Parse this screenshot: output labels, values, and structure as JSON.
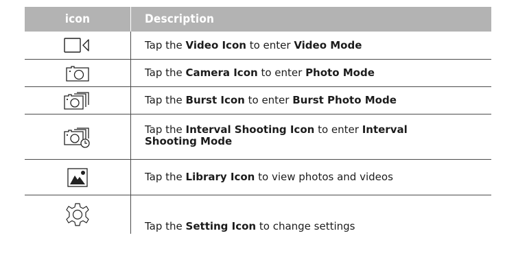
{
  "table": {
    "header": {
      "icon_col": "icon",
      "desc_col": "Description"
    },
    "rows": [
      {
        "icon": "video-camera-icon",
        "pre": "Tap the ",
        "name": "Video Icon",
        "mid": " to enter ",
        "target": "Video Mode",
        "post": ""
      },
      {
        "icon": "camera-icon",
        "pre": "Tap the ",
        "name": "Camera Icon",
        "mid": " to enter ",
        "target": "Photo Mode",
        "post": ""
      },
      {
        "icon": "burst-icon",
        "pre": "Tap the ",
        "name": "Burst Icon",
        "mid": " to enter ",
        "target": "Burst Photo Mode",
        "post": ""
      },
      {
        "icon": "interval-shooting-icon",
        "pre": "Tap the ",
        "name": "Interval Shooting Icon",
        "mid": " to enter ",
        "target": "Interval Shooting Mode",
        "post": ""
      },
      {
        "icon": "library-icon",
        "pre": "Tap the ",
        "name": "Library Icon",
        "mid": " to view photos and videos",
        "target": "",
        "post": ""
      },
      {
        "icon": "settings-icon",
        "pre": "Tap the ",
        "name": "Setting Icon",
        "mid": " to change settings",
        "target": "",
        "post": ""
      }
    ]
  }
}
